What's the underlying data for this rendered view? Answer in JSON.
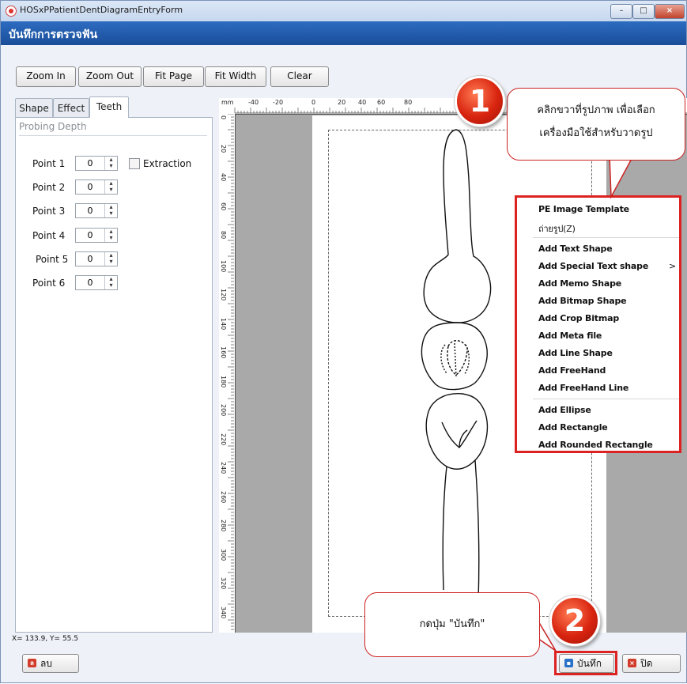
{
  "window": {
    "title": "HOSxPPatientDentDiagramEntryForm",
    "btn_min": "–",
    "btn_max": "□",
    "btn_close": "×"
  },
  "header": {
    "title": "บันทึกการตรวจฟัน"
  },
  "toolbar": {
    "zoom_in": "Zoom In",
    "zoom_out": "Zoom Out",
    "fit_page": "Fit Page",
    "fit_width": "Fit Width",
    "clear": "Clear"
  },
  "tabs": [
    "Shape",
    "Effect",
    "Teeth"
  ],
  "probing": {
    "title": "Probing Depth",
    "extraction_label": "Extraction",
    "points": [
      {
        "label": "Point 1",
        "value": "0"
      },
      {
        "label": "Point 2",
        "value": "0"
      },
      {
        "label": "Point 3",
        "value": "0"
      },
      {
        "label": "Point 4",
        "value": "0"
      },
      {
        "label": "Point 5",
        "value": "0"
      },
      {
        "label": "Point 6",
        "value": "0"
      }
    ]
  },
  "ruler": {
    "unit": "mm",
    "top_labels": [
      "-40",
      "-20",
      "0",
      "20",
      "40",
      "60",
      "80"
    ],
    "left_labels": [
      "0",
      "20",
      "40",
      "60",
      "80",
      "100",
      "120",
      "140",
      "160",
      "180",
      "200",
      "220",
      "240",
      "260",
      "280",
      "300",
      "320",
      "340"
    ]
  },
  "context_menu": {
    "items": [
      "PE Image Template",
      "ถ่ายรูป(Z)",
      "Add Text Shape",
      "Add Special Text shape",
      "Add Memo Shape",
      "Add Bitmap Shape",
      "Add Crop Bitmap",
      "Add Meta file",
      "Add Line Shape",
      "Add FreeHand",
      "Add FreeHand Line",
      "Add Ellipse",
      "Add Rectangle",
      "Add Rounded Rectangle"
    ],
    "submenu_arrow": ">"
  },
  "callouts": {
    "step1_number": "1",
    "step1_line1": "คลิกขวาที่รูปภาพ เพื่อเลือก",
    "step1_line2": "เครื่องมือใช้สำหรับวาดรูป",
    "step2_number": "2",
    "step2_text": "กดปุ่ม \"บันทึก\""
  },
  "status": {
    "coords": "X= 133.9, Y=  55.5"
  },
  "bottom": {
    "delete_label": "ลบ",
    "save_label": "บันทึก",
    "close_label": "ปิด"
  },
  "colors": {
    "header_bg": "#1a4e9a",
    "highlight": "#dd2222"
  }
}
